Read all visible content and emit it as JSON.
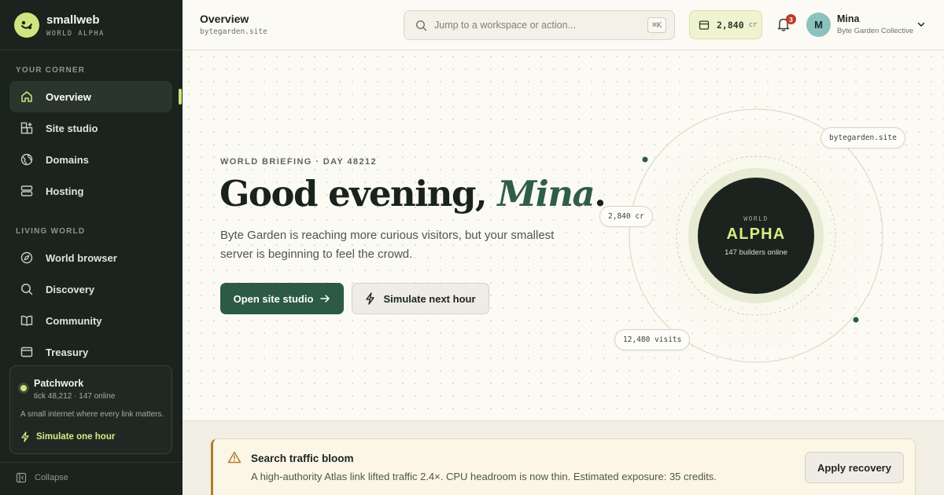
{
  "brand": {
    "name": "smallweb",
    "subtitle": "WORLD ALPHA"
  },
  "sidebar": {
    "sections": [
      {
        "label": "YOUR CORNER",
        "items": [
          {
            "label": "Overview",
            "icon": "home-icon",
            "active": true
          },
          {
            "label": "Site studio",
            "icon": "grid-plus-icon"
          },
          {
            "label": "Domains",
            "icon": "globe-icon"
          },
          {
            "label": "Hosting",
            "icon": "server-icon"
          }
        ]
      },
      {
        "label": "LIVING WORLD",
        "items": [
          {
            "label": "World browser",
            "icon": "compass-icon"
          },
          {
            "label": "Discovery",
            "icon": "search-icon"
          },
          {
            "label": "Community",
            "icon": "book-open-icon"
          },
          {
            "label": "Treasury",
            "icon": "wallet-icon"
          }
        ]
      }
    ],
    "world_card": {
      "title": "Patchwork",
      "tick": "tick 48,212 · 147 online",
      "description": "A small internet where every link matters.",
      "action": "Simulate one hour"
    },
    "collapse_label": "Collapse"
  },
  "topbar": {
    "title": "Overview",
    "subtitle": "bytegarden.site",
    "search_placeholder": "Jump to a workspace or action...",
    "shortcut": "⌘K",
    "credits": {
      "value": "2,840",
      "unit": "cr"
    },
    "notifications_count": "3",
    "user": {
      "initial": "M",
      "name": "Mina",
      "org": "Byte Garden Collective"
    }
  },
  "hero": {
    "eyebrow": "WORLD BRIEFING · DAY 48212",
    "greeting_prefix": "Good evening, ",
    "greeting_name": "Mina",
    "greeting_suffix": ".",
    "description": "Byte Garden is reaching more curious visitors, but your smallest server is beginning to feel the crowd.",
    "primary_button": "Open site studio",
    "secondary_button": "Simulate next hour",
    "orbit": {
      "labels": {
        "site": "bytegarden.site",
        "credits": "2,840 cr",
        "visits": "12,480 visits"
      },
      "core": {
        "label": "WORLD",
        "name": "ALPHA",
        "sub": "147 builders online"
      }
    }
  },
  "alert": {
    "title": "Search traffic bloom",
    "description": "A high-authority Atlas link lifted traffic 2.4×. CPU headroom is now thin. Estimated exposure: 35 credits.",
    "action": "Apply recovery"
  },
  "colors": {
    "sidebar_bg": "#1b231e",
    "accent_lime": "#cfe57f",
    "primary_green": "#2c5a45",
    "warning": "#b07d2e",
    "badge_red": "#c0392b"
  }
}
